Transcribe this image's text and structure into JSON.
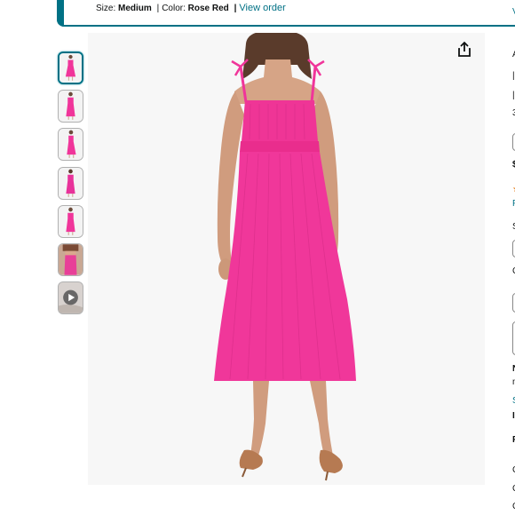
{
  "order": {
    "size_label": "Size:",
    "size_value": "Medium",
    "separator": "|",
    "color_label": "Color:",
    "color_value": "Rose Red",
    "view_order": "View order"
  },
  "product": {
    "dress_color": "#f0359a",
    "thumbnails": [
      {
        "name": "thumb-1",
        "kind": "dress-front"
      },
      {
        "name": "thumb-2",
        "kind": "dress-front"
      },
      {
        "name": "thumb-3",
        "kind": "dress-side"
      },
      {
        "name": "thumb-4",
        "kind": "dress-back"
      },
      {
        "name": "thumb-5",
        "kind": "dress-front"
      },
      {
        "name": "thumb-6",
        "kind": "dress-closeup"
      },
      {
        "name": "thumb-7",
        "kind": "video"
      }
    ],
    "share_icon": "share-icon"
  },
  "right_column": {
    "fragments": [
      "V",
      "A",
      "|",
      "|",
      "3",
      "$",
      "F",
      "S",
      "C",
      "N",
      "n",
      "S",
      "I",
      "F",
      "C",
      "C",
      "C"
    ]
  },
  "colors": {
    "accent": "#007185",
    "background": "#ffffff"
  }
}
